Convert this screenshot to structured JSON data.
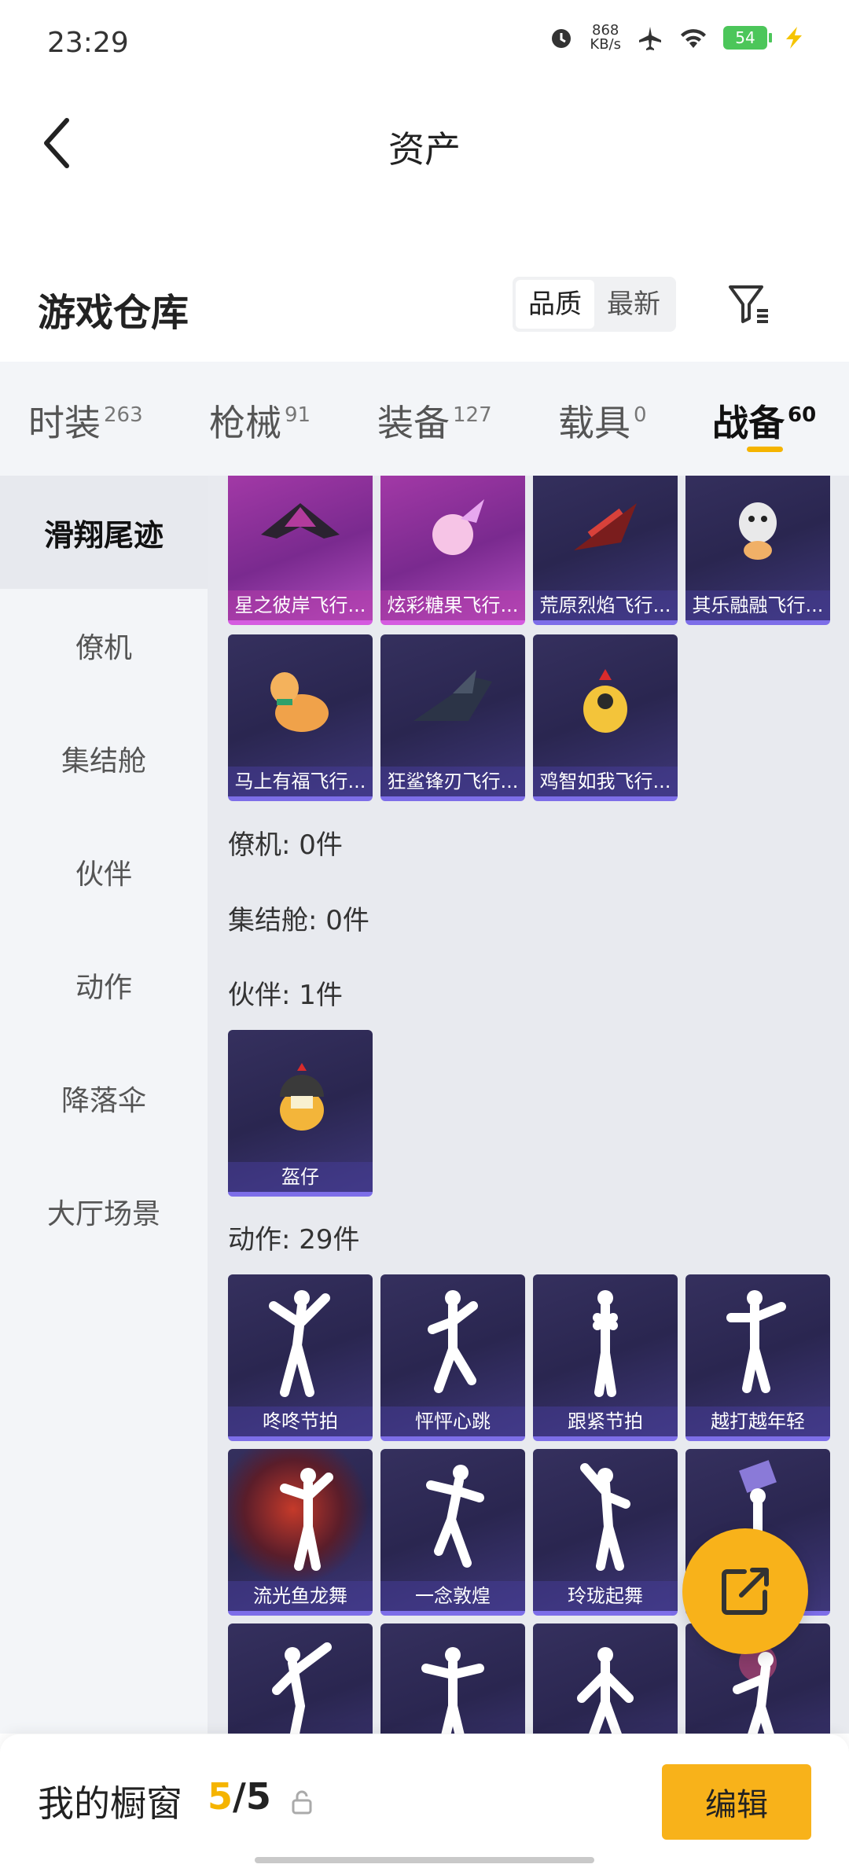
{
  "status_bar": {
    "time": "23:29",
    "net_speed": "868",
    "net_unit": "KB/s",
    "battery": "54"
  },
  "header": {
    "title": "资产"
  },
  "warehouse": {
    "title": "游戏仓库",
    "sort_quality": "品质",
    "sort_newest": "最新"
  },
  "tabs": [
    {
      "label": "时装",
      "count": "263"
    },
    {
      "label": "枪械",
      "count": "91"
    },
    {
      "label": "装备",
      "count": "127"
    },
    {
      "label": "载具",
      "count": "0"
    },
    {
      "label": "战备",
      "count": "60"
    }
  ],
  "side_nav": [
    "滑翔尾迹",
    "僚机",
    "集结舱",
    "伙伴",
    "动作",
    "降落伞",
    "大厅场景"
  ],
  "content": {
    "glide_items": [
      "星之彼岸飞行...",
      "炫彩糖果飞行...",
      "荒原烈焰飞行...",
      "其乐融融飞行...",
      "马上有福飞行...",
      "狂鲨锋刃飞行...",
      "鸡智如我飞行..."
    ],
    "sections": {
      "wingman": "僚机: 0件",
      "pod": "集结舱: 0件",
      "partner": "伙伴: 1件",
      "emote": "动作: 29件"
    },
    "partner_items": [
      "盔仔"
    ],
    "emote_items": [
      "咚咚节拍",
      "怦怦心跳",
      "跟紧节拍",
      "越打越年轻",
      "流光鱼龙舞",
      "一念敦煌",
      "玲珑起舞"
    ]
  },
  "bottom": {
    "title": "我的橱窗",
    "count_current": "5",
    "count_total": "/5",
    "edit": "编辑"
  },
  "colors": {
    "accent": "#f8b21a",
    "card_purple": "#2a2650",
    "card_pink": "#a53aa8"
  }
}
